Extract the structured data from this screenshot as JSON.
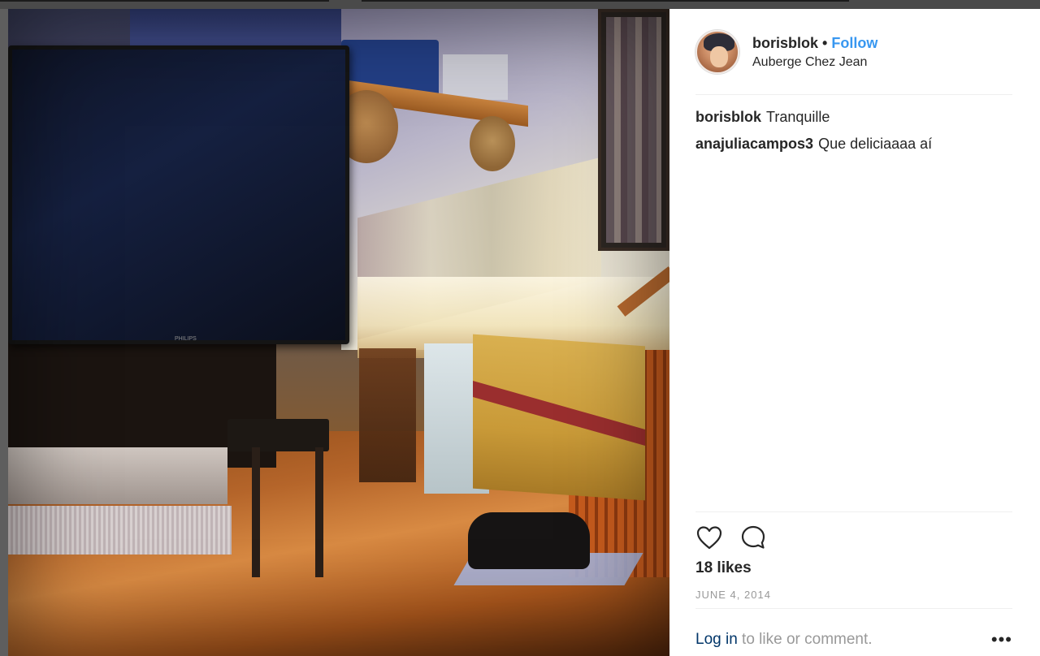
{
  "post": {
    "username": "borisblok",
    "separator": "•",
    "follow_label": "Follow",
    "location": "Auberge Chez Jean",
    "photo_brand_text": "PHILIPS"
  },
  "comments": [
    {
      "author": "borisblok",
      "text": "Tranquille"
    },
    {
      "author": "anajuliacampos3",
      "text": "Que deliciaaaa aí"
    }
  ],
  "actions": {
    "like_icon": "heart-icon",
    "comment_icon": "comment-bubble-icon"
  },
  "likes_text": "18 likes",
  "date_text": "JUNE 4, 2014",
  "footer": {
    "login_label": "Log in",
    "rest_text": " to like or comment.",
    "more_label": "•••"
  },
  "colors": {
    "follow": "#3897f0",
    "login": "#003569",
    "muted": "#999999",
    "text": "#262626"
  }
}
